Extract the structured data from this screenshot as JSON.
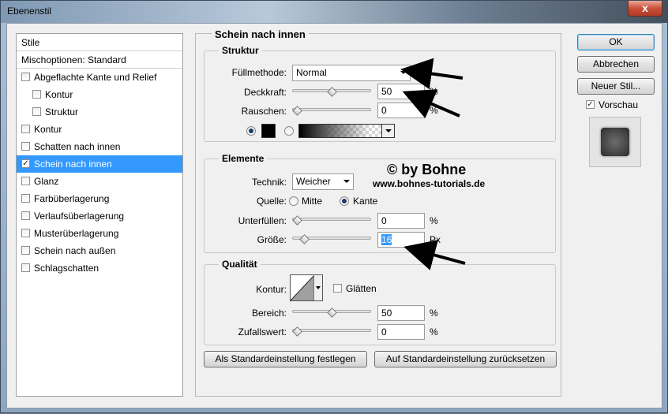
{
  "window": {
    "title": "Ebenenstil",
    "close_label": "x"
  },
  "left_panel": {
    "header": "Stile",
    "blend_options": "Mischoptionen: Standard",
    "items": [
      {
        "label": "Abgeflachte Kante und Relief",
        "checked": false,
        "indent": false
      },
      {
        "label": "Kontur",
        "checked": false,
        "indent": true
      },
      {
        "label": "Struktur",
        "checked": false,
        "indent": true
      },
      {
        "label": "Kontur",
        "checked": false,
        "indent": false
      },
      {
        "label": "Schatten nach innen",
        "checked": false,
        "indent": false
      },
      {
        "label": "Schein nach innen",
        "checked": true,
        "indent": false,
        "selected": true
      },
      {
        "label": "Glanz",
        "checked": false,
        "indent": false
      },
      {
        "label": "Farbüberlagerung",
        "checked": false,
        "indent": false
      },
      {
        "label": "Verlaufsüberlagerung",
        "checked": false,
        "indent": false
      },
      {
        "label": "Musterüberlagerung",
        "checked": false,
        "indent": false
      },
      {
        "label": "Schein nach außen",
        "checked": false,
        "indent": false
      },
      {
        "label": "Schlagschatten",
        "checked": false,
        "indent": false
      }
    ]
  },
  "main": {
    "title": "Schein nach innen",
    "struktur": {
      "title": "Struktur",
      "blend_mode_label": "Füllmethode:",
      "blend_mode_value": "Normal",
      "opacity_label": "Deckkraft:",
      "opacity_value": "50",
      "opacity_unit": "%",
      "opacity_slider": 0.5,
      "noise_label": "Rauschen:",
      "noise_value": "0",
      "noise_unit": "%",
      "noise_slider": 0.0,
      "color_mode": "solid",
      "color": "#000000"
    },
    "elemente": {
      "title": "Elemente",
      "technique_label": "Technik:",
      "technique_value": "Weicher",
      "source_label": "Quelle:",
      "source_center": "Mitte",
      "source_edge": "Kante",
      "source_selected": "edge",
      "choke_label": "Unterfüllen:",
      "choke_value": "0",
      "choke_unit": "%",
      "choke_slider": 0.0,
      "size_label": "Größe:",
      "size_value": "16",
      "size_unit": "Px",
      "size_slider": 0.1
    },
    "qualitaet": {
      "title": "Qualität",
      "contour_label": "Kontur:",
      "antialias_label": "Glätten",
      "antialias_checked": false,
      "range_label": "Bereich:",
      "range_value": "50",
      "range_unit": "%",
      "range_slider": 0.5,
      "jitter_label": "Zufallswert:",
      "jitter_value": "0",
      "jitter_unit": "%",
      "jitter_slider": 0.0
    },
    "make_default": "Als Standardeinstellung festlegen",
    "reset_default": "Auf Standardeinstellung zurücksetzen"
  },
  "watermark": {
    "line1": "© by Bohne",
    "line2": "www.bohnes-tutorials.de"
  },
  "right_panel": {
    "ok": "OK",
    "cancel": "Abbrechen",
    "new_style": "Neuer Stil...",
    "preview_label": "Vorschau",
    "preview_checked": true
  }
}
